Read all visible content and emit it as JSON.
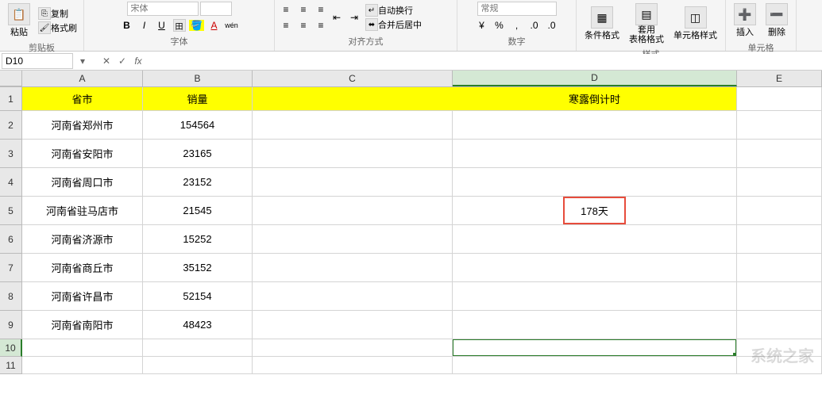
{
  "ribbon": {
    "clipboard": {
      "paste": "粘贴",
      "copy": "复制",
      "format_painter": "格式刷",
      "group": "剪贴板"
    },
    "font": {
      "name_placeholder": "宋体",
      "bold": "B",
      "italic": "I",
      "underline": "U",
      "group": "字体",
      "wen": "wén"
    },
    "alignment": {
      "merge_after": "合并后居中",
      "group": "对齐方式",
      "auto_wrap": "自动换行"
    },
    "number": {
      "general": "常规",
      "group": "数字"
    },
    "styles": {
      "cond_fmt": "条件格式",
      "table_fmt": "套用\n表格格式",
      "cell_style": "单元格样式",
      "group": "样式"
    },
    "cells": {
      "insert": "插入",
      "delete": "删除",
      "group": "单元格"
    }
  },
  "name_box": "D10",
  "fx_label": "fx",
  "columns": [
    "A",
    "B",
    "C",
    "D",
    "E"
  ],
  "row_numbers": [
    1,
    2,
    3,
    4,
    5,
    6,
    7,
    8,
    9,
    10,
    11
  ],
  "headers": {
    "province": "省市",
    "sales": "销量",
    "countdown": "寒露倒计时"
  },
  "data_rows": [
    {
      "province": "河南省郑州市",
      "sales": "154564"
    },
    {
      "province": "河南省安阳市",
      "sales": "23165"
    },
    {
      "province": "河南省周口市",
      "sales": "23152"
    },
    {
      "province": "河南省驻马店市",
      "sales": "21545"
    },
    {
      "province": "河南省济源市",
      "sales": "15252"
    },
    {
      "province": "河南省商丘市",
      "sales": "35152"
    },
    {
      "province": "河南省许昌市",
      "sales": "52154"
    },
    {
      "province": "河南省南阳市",
      "sales": "48423"
    }
  ],
  "countdown_value": "178天",
  "watermark": "系统之家"
}
